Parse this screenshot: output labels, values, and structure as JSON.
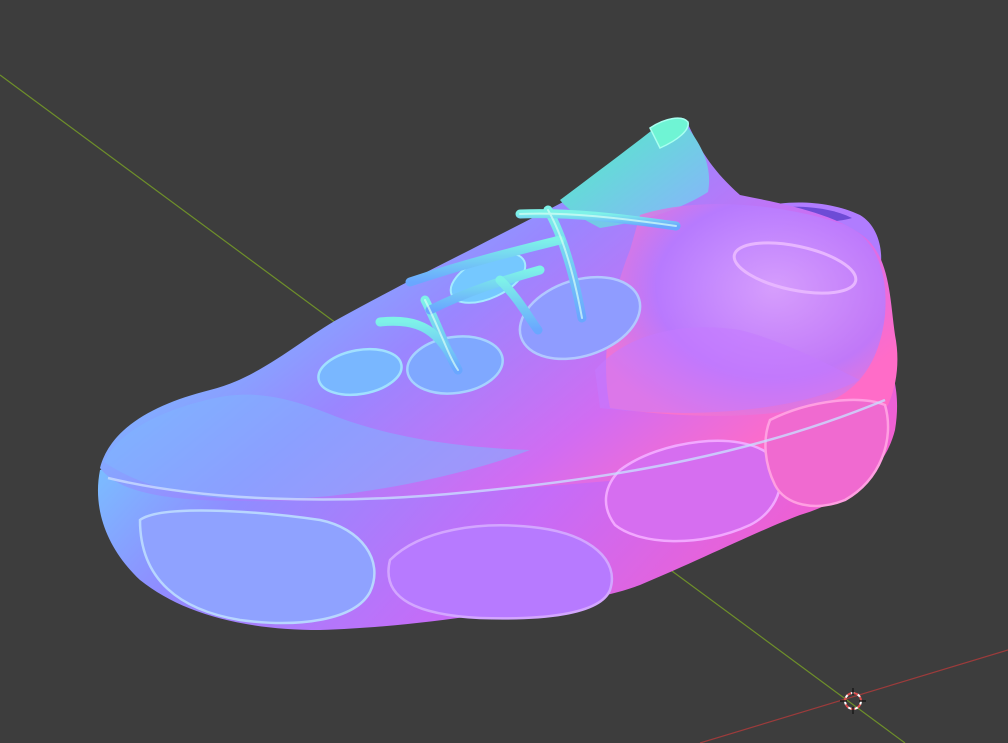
{
  "viewport": {
    "background_color": "#3d3d3d",
    "axes": {
      "x_axis_color": "#c0504d",
      "y_axis_color": "#7a9a2c"
    },
    "model": {
      "name": "sneaker",
      "shading": "normal-map",
      "palette": {
        "green": "#5ef0b0",
        "cyan": "#6fd6ff",
        "blue": "#7a8cff",
        "purple": "#b469ff",
        "magenta": "#f06ad8",
        "pink": "#ff6fc4"
      }
    },
    "cursor_icon": "3d-cursor-icon"
  }
}
